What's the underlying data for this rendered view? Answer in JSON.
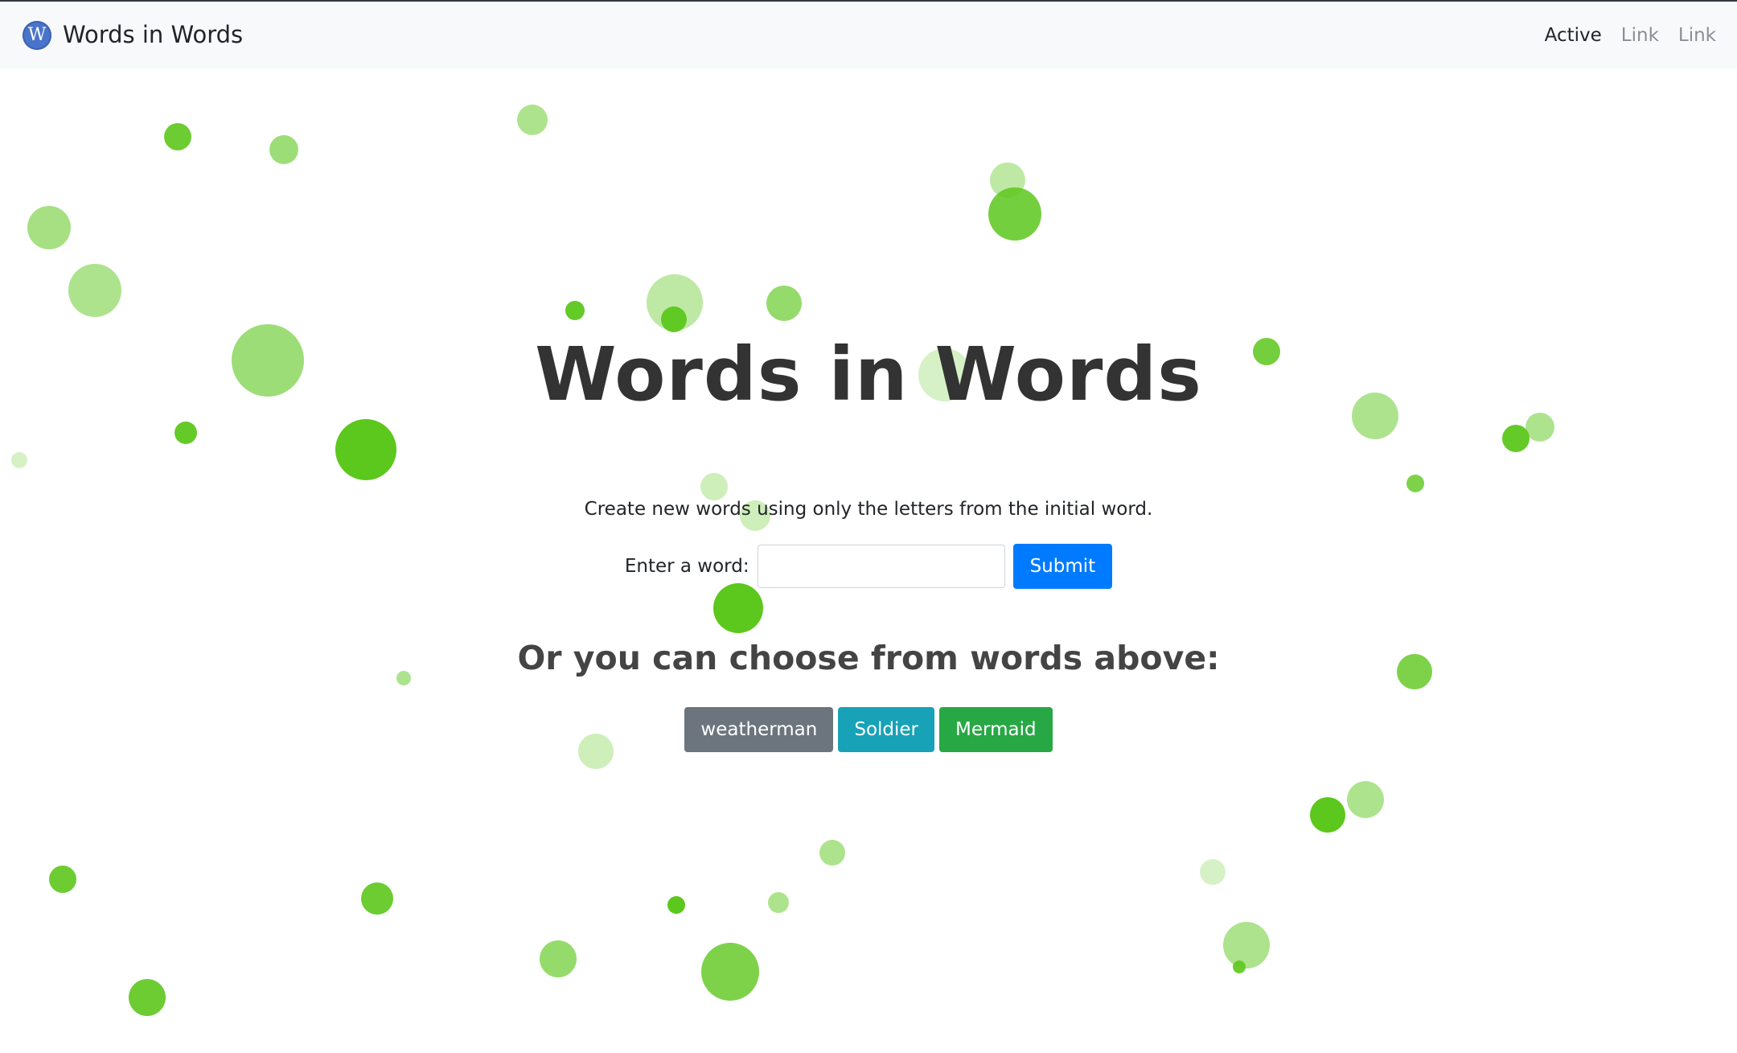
{
  "navbar": {
    "brand_logo_letter": "W",
    "brand_name": "Words in Words",
    "links": [
      {
        "label": "Active",
        "active": true
      },
      {
        "label": "Link",
        "active": false
      },
      {
        "label": "Link",
        "active": false
      }
    ]
  },
  "main": {
    "title": "Words in Words",
    "lead": "Create new words using only the letters from the initial word.",
    "form": {
      "label": "Enter a word:",
      "input_value": "",
      "input_placeholder": "",
      "submit_label": "Submit"
    },
    "subheading": "Or you can choose from words above:",
    "word_choices": [
      {
        "label": "weatherman",
        "style": "secondary"
      },
      {
        "label": "Soldier",
        "style": "info"
      },
      {
        "label": "Mermaid",
        "style": "success"
      }
    ]
  },
  "colors": {
    "primary": "#007bff",
    "secondary": "#6c757d",
    "info": "#17a2b8",
    "success": "#28a745",
    "bubble_green": "#5cc71c"
  }
}
